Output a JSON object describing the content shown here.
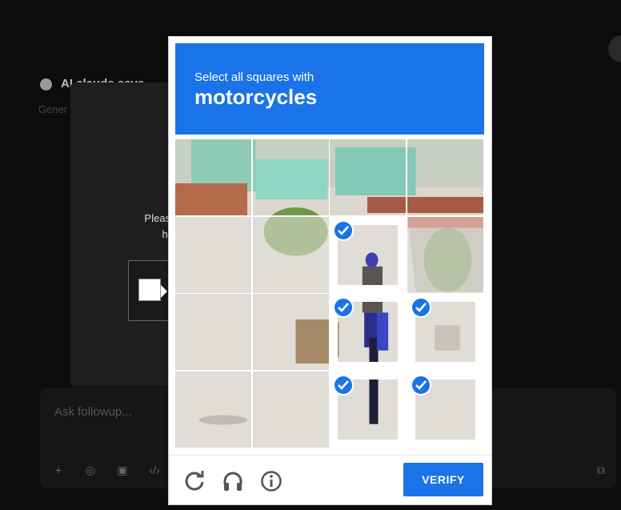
{
  "background": {
    "title_text": "AI claude save...",
    "subtitle_text": "Gener",
    "prompt_text_line1": "Please comp",
    "prompt_text_line2": "helps",
    "input_placeholder": "Ask followup..."
  },
  "captcha": {
    "instruction": "Select all squares with",
    "target": "motorcycles",
    "verify_label": "VERIFY",
    "grid_rows": 4,
    "grid_cols": 4,
    "selected": [
      false,
      false,
      false,
      false,
      false,
      false,
      true,
      false,
      false,
      false,
      true,
      true,
      false,
      false,
      true,
      true
    ],
    "colors": {
      "accent": "#1a73e8",
      "header_text": "#ffffff"
    }
  },
  "icons": {
    "reload": "reload-icon",
    "audio": "headphones-icon",
    "info": "info-icon",
    "check": "check-icon"
  }
}
